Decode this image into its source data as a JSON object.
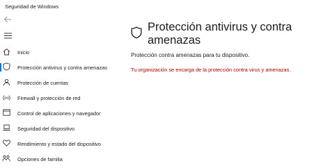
{
  "app": {
    "title": "Seguridad de Windows"
  },
  "sidebar": {
    "items": [
      {
        "label": "Inicio",
        "icon": "home-icon"
      },
      {
        "label": "Protección antivirus y contra amenazas",
        "icon": "shield-icon",
        "active": true
      },
      {
        "label": "Protección de cuentas",
        "icon": "person-icon"
      },
      {
        "label": "Firewall y protección de red",
        "icon": "wifi-icon"
      },
      {
        "label": "Control de aplicaciones y navegador",
        "icon": "app-browser-icon"
      },
      {
        "label": "Seguridad del dispositivo",
        "icon": "laptop-icon"
      },
      {
        "label": "Rendimiento y estado del dispositivo",
        "icon": "heart-icon"
      },
      {
        "label": "Opciones de familia",
        "icon": "family-icon"
      }
    ]
  },
  "main": {
    "title": "Protección antivirus y contra amenazas",
    "subtitle": "Protección contra amenazas para tu dispositivo.",
    "org_note": "Tu organización se encarga de la protección contra virus y amenazas."
  },
  "colors": {
    "accent": "#0078d7",
    "warning_text": "#a80000"
  }
}
